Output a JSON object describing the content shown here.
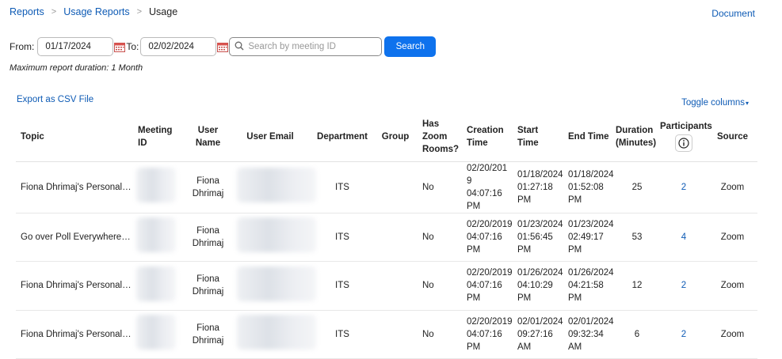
{
  "breadcrumb": {
    "items": [
      "Reports",
      "Usage Reports",
      "Usage"
    ]
  },
  "header": {
    "document_link": "Document"
  },
  "filters": {
    "from_label": "From:",
    "from_value": "01/17/2024",
    "to_label": "To:",
    "to_value": "02/02/2024",
    "search_placeholder": "Search by meeting ID",
    "search_button": "Search",
    "max_duration_note": "Maximum report duration: 1 Month"
  },
  "actions": {
    "export_csv": "Export as CSV File",
    "toggle_columns": "Toggle columns"
  },
  "icons": {
    "calendar": "calendar-icon",
    "search": "search-icon",
    "info": "info-icon",
    "caret": "caret-down-icon"
  },
  "colors": {
    "link": "#0e5bb5",
    "primary_button": "#0e72ed"
  },
  "table": {
    "headers": {
      "topic": "Topic",
      "meeting_id": "Meeting ID",
      "user_name": "User Name",
      "user_email": "User Email",
      "department": "Department",
      "group": "Group",
      "has_zoom_rooms": "Has Zoom Rooms?",
      "creation_time": "Creation Time",
      "start_time": "Start Time",
      "end_time": "End Time",
      "duration": "Duration (Minutes)",
      "participants": "Participants",
      "source": "Source"
    },
    "rows": [
      {
        "topic": "Fiona Dhrimaj's Personal ...",
        "user_name": "Fiona Dhrimaj",
        "department": "ITS",
        "group": "",
        "has_zoom_rooms": "No",
        "creation_time": "02/20/2019 04:07:16 PM",
        "start_time": "01/18/2024 01:27:18 PM",
        "end_time": "01/18/2024 01:52:08 PM",
        "duration": "25",
        "participants": "2",
        "source": "Zoom"
      },
      {
        "topic": "Go over Poll Everywhere - ...",
        "user_name": "Fiona Dhrimaj",
        "department": "ITS",
        "group": "",
        "has_zoom_rooms": "No",
        "creation_time": "02/20/2019 04:07:16 PM",
        "start_time": "01/23/2024 01:56:45 PM",
        "end_time": "01/23/2024 02:49:17 PM",
        "duration": "53",
        "participants": "4",
        "source": "Zoom"
      },
      {
        "topic": "Fiona Dhrimaj's Personal ...",
        "user_name": "Fiona Dhrimaj",
        "department": "ITS",
        "group": "",
        "has_zoom_rooms": "No",
        "creation_time": "02/20/2019 04:07:16 PM",
        "start_time": "01/26/2024 04:10:29 PM",
        "end_time": "01/26/2024 04:21:58 PM",
        "duration": "12",
        "participants": "2",
        "source": "Zoom"
      },
      {
        "topic": "Fiona Dhrimaj's Personal ...",
        "user_name": "Fiona Dhrimaj",
        "department": "ITS",
        "group": "",
        "has_zoom_rooms": "No",
        "creation_time": "02/20/2019 04:07:16 PM",
        "start_time": "02/01/2024 09:27:16 AM",
        "end_time": "02/01/2024 09:32:34 AM",
        "duration": "6",
        "participants": "2",
        "source": "Zoom"
      }
    ]
  }
}
